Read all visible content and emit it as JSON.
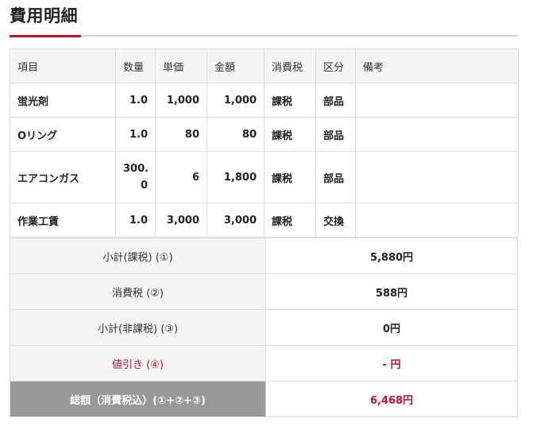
{
  "page": {
    "title": "費用明細"
  },
  "detail": {
    "headers": [
      "項目",
      "数量",
      "単価",
      "金額",
      "消費税",
      "区分",
      "備考"
    ],
    "rows": [
      {
        "item": "蛍光剤",
        "qty": "1.0",
        "unit_price": "1,000",
        "amount": "1,000",
        "tax": "課税",
        "category": "部品",
        "note": ""
      },
      {
        "item": "Oリング",
        "qty": "1.0",
        "unit_price": "80",
        "amount": "80",
        "tax": "課税",
        "category": "部品",
        "note": ""
      },
      {
        "item": "エアコンガス",
        "qty_line1": "300.",
        "qty_line2": "0",
        "unit_price": "6",
        "amount": "1,800",
        "tax": "課税",
        "category": "部品",
        "note": ""
      },
      {
        "item": "作業工賃",
        "qty": "1.0",
        "unit_price": "3,000",
        "amount": "3,000",
        "tax": "課税",
        "category": "交換",
        "note": ""
      }
    ]
  },
  "summary": {
    "subtotal_taxable_label": "小計(課税) (①)",
    "subtotal_taxable_value": "5,880円",
    "consumption_tax_label": "消費税 (②)",
    "consumption_tax_value": "588円",
    "subtotal_nontaxable_label": "小計(非課税) (③)",
    "subtotal_nontaxable_value": "0円",
    "discount_label": "値引き (④)",
    "discount_value": "- 円",
    "total_label": "総額（消費税込）(①+②+③)",
    "total_value": "6,468円"
  },
  "colors": {
    "accent": "#c8102e",
    "header_bg": "#f4f4f4",
    "total_label_bg": "#999999"
  }
}
